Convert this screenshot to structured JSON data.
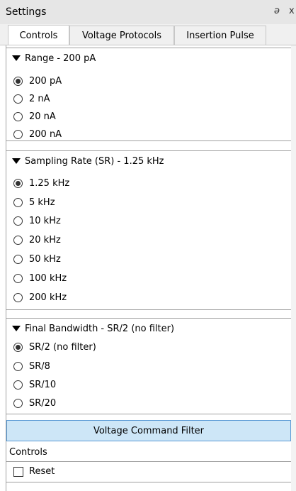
{
  "window": {
    "title": "Settings",
    "float_icon": "ɘ",
    "close_icon": "x"
  },
  "tabs": [
    {
      "label": "Controls",
      "active": true
    },
    {
      "label": "Voltage Protocols",
      "active": false
    },
    {
      "label": "Insertion Pulse",
      "active": false
    }
  ],
  "range": {
    "title": "Range - 200 pA",
    "options": [
      "200 pA",
      "2 nA",
      "20 nA",
      "200 nA"
    ],
    "selected": "200 pA"
  },
  "sampling": {
    "title": "Sampling Rate (SR) - 1.25 kHz",
    "options": [
      "1.25 kHz",
      "5 kHz",
      "10 kHz",
      "20 kHz",
      "50 kHz",
      "100 kHz",
      "200 kHz"
    ],
    "selected": "1.25 kHz"
  },
  "bandwidth": {
    "title": "Final Bandwidth - SR/2 (no filter)",
    "options": [
      "SR/2 (no filter)",
      "SR/8",
      "SR/10",
      "SR/20"
    ],
    "selected": "SR/2 (no filter)"
  },
  "voltage_filter_button": "Voltage Command Filter",
  "controls": {
    "label": "Controls",
    "reset_label": "Reset",
    "reset_checked": false
  },
  "colors": {
    "button_bg": "#cde6f7",
    "button_border": "#5b9bd5"
  }
}
